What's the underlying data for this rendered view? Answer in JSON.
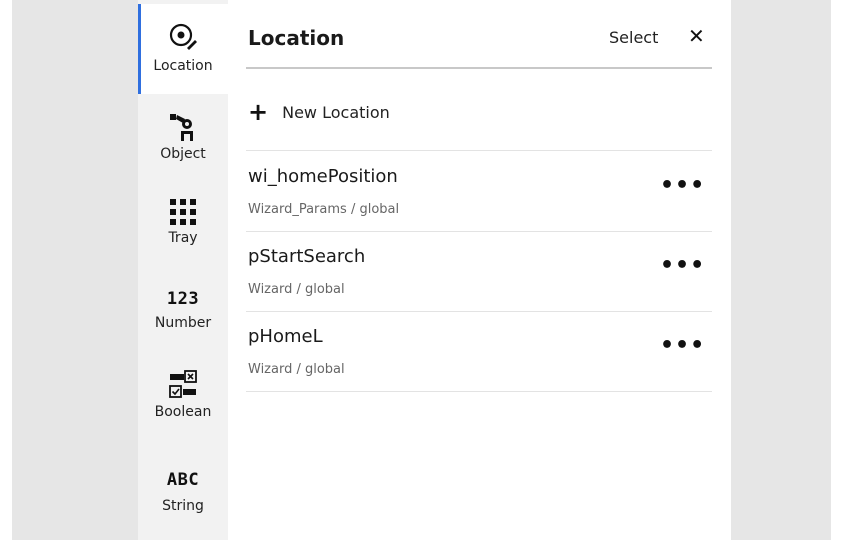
{
  "rail": {
    "items": [
      {
        "label": "Location",
        "icon": "location-target-icon"
      },
      {
        "label": "Object",
        "icon": "robot-gripper-icon"
      },
      {
        "label": "Tray",
        "icon": "grid-dots-icon"
      },
      {
        "label": "Number",
        "icon": "number-icon",
        "glyph": "123"
      },
      {
        "label": "Boolean",
        "icon": "boolean-toggle-icon"
      },
      {
        "label": "String",
        "icon": "string-abc-icon",
        "glyph": "ABC"
      }
    ],
    "active": "Location",
    "accent_color": "#2f6fdf"
  },
  "header": {
    "title": "Location",
    "select_label": "Select",
    "close_glyph": "✕"
  },
  "new_location_label": "New Location",
  "plus_glyph": "+",
  "more_glyph": "•••",
  "locations": [
    {
      "name": "wi_homePosition",
      "scope": "Wizard_Params / global"
    },
    {
      "name": "pStartSearch",
      "scope": "Wizard / global"
    },
    {
      "name": "pHomeL",
      "scope": "Wizard / global"
    }
  ]
}
